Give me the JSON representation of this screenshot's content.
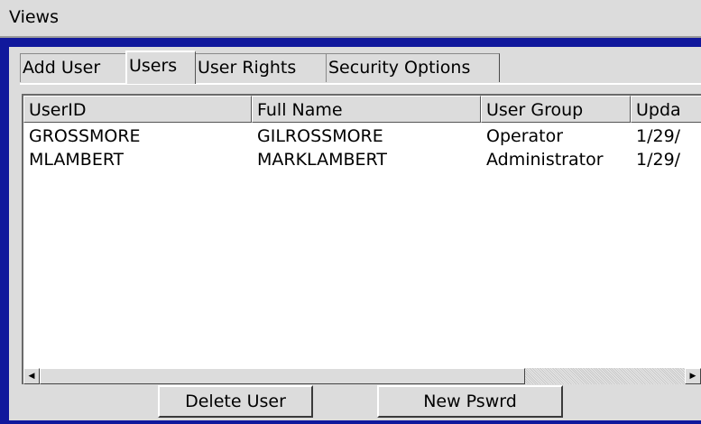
{
  "menubar": {
    "title": "Views"
  },
  "tabs": [
    {
      "label": "Add User"
    },
    {
      "label": "Users"
    },
    {
      "label": "User Rights"
    },
    {
      "label": "Security Options"
    }
  ],
  "active_tab": "Users",
  "table": {
    "columns": [
      "UserID",
      "Full Name",
      "User Group",
      "Upda"
    ],
    "rows": [
      [
        "GROSSMORE",
        "GILROSSMORE",
        "Operator",
        "1/29/"
      ],
      [
        "MLAMBERT",
        "MARKLAMBERT",
        "Administrator",
        "1/29/"
      ]
    ]
  },
  "scrollbar": {
    "left_arrow": "◀",
    "right_arrow": "▶"
  },
  "buttons": {
    "delete_user": "Delete User",
    "new_password": "New Pswrd"
  },
  "colors": {
    "window_frame": "#10189c",
    "panel": "#dcdcdc",
    "list_bg": "#ffffff"
  }
}
